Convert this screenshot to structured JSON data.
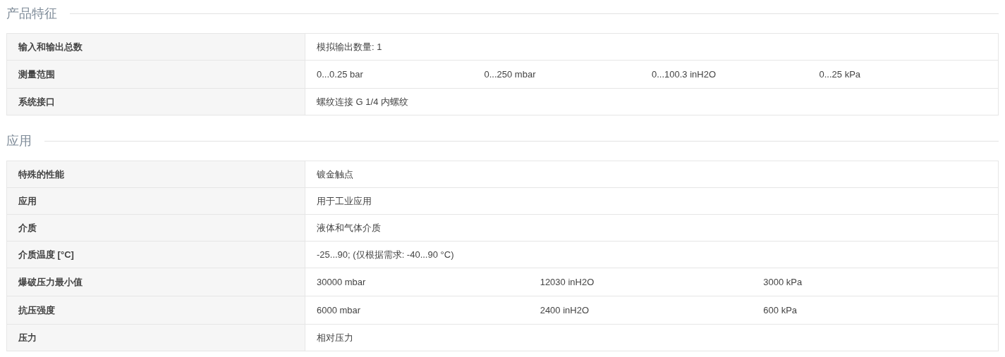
{
  "sections": [
    {
      "title": "产品特征",
      "rows": [
        {
          "label": "输入和输出总数",
          "values": [
            "模拟输出数量: 1"
          ]
        },
        {
          "label": "测量范围",
          "values": [
            "0...0.25 bar",
            "0...250 mbar",
            "0...100.3 inH2O",
            "0...25 kPa"
          ]
        },
        {
          "label": "系统接口",
          "values": [
            "螺纹连接 G 1/4 内螺纹"
          ]
        }
      ]
    },
    {
      "title": "应用",
      "rows": [
        {
          "label": "特殊的性能",
          "values": [
            "镀金触点"
          ]
        },
        {
          "label": "应用",
          "values": [
            "用于工业应用"
          ]
        },
        {
          "label": "介质",
          "values": [
            "液体和气体介质"
          ]
        },
        {
          "label": "介质温度 [°C]",
          "values": [
            "-25...90; (仅根据需求: -40...90 °C)"
          ]
        },
        {
          "label": "爆破压力最小值",
          "values": [
            "30000 mbar",
            "12030 inH2O",
            "3000 kPa"
          ]
        },
        {
          "label": "抗压强度",
          "values": [
            "6000 mbar",
            "2400 inH2O",
            "600 kPa"
          ]
        },
        {
          "label": "压力",
          "values": [
            "相对压力"
          ]
        }
      ]
    }
  ]
}
